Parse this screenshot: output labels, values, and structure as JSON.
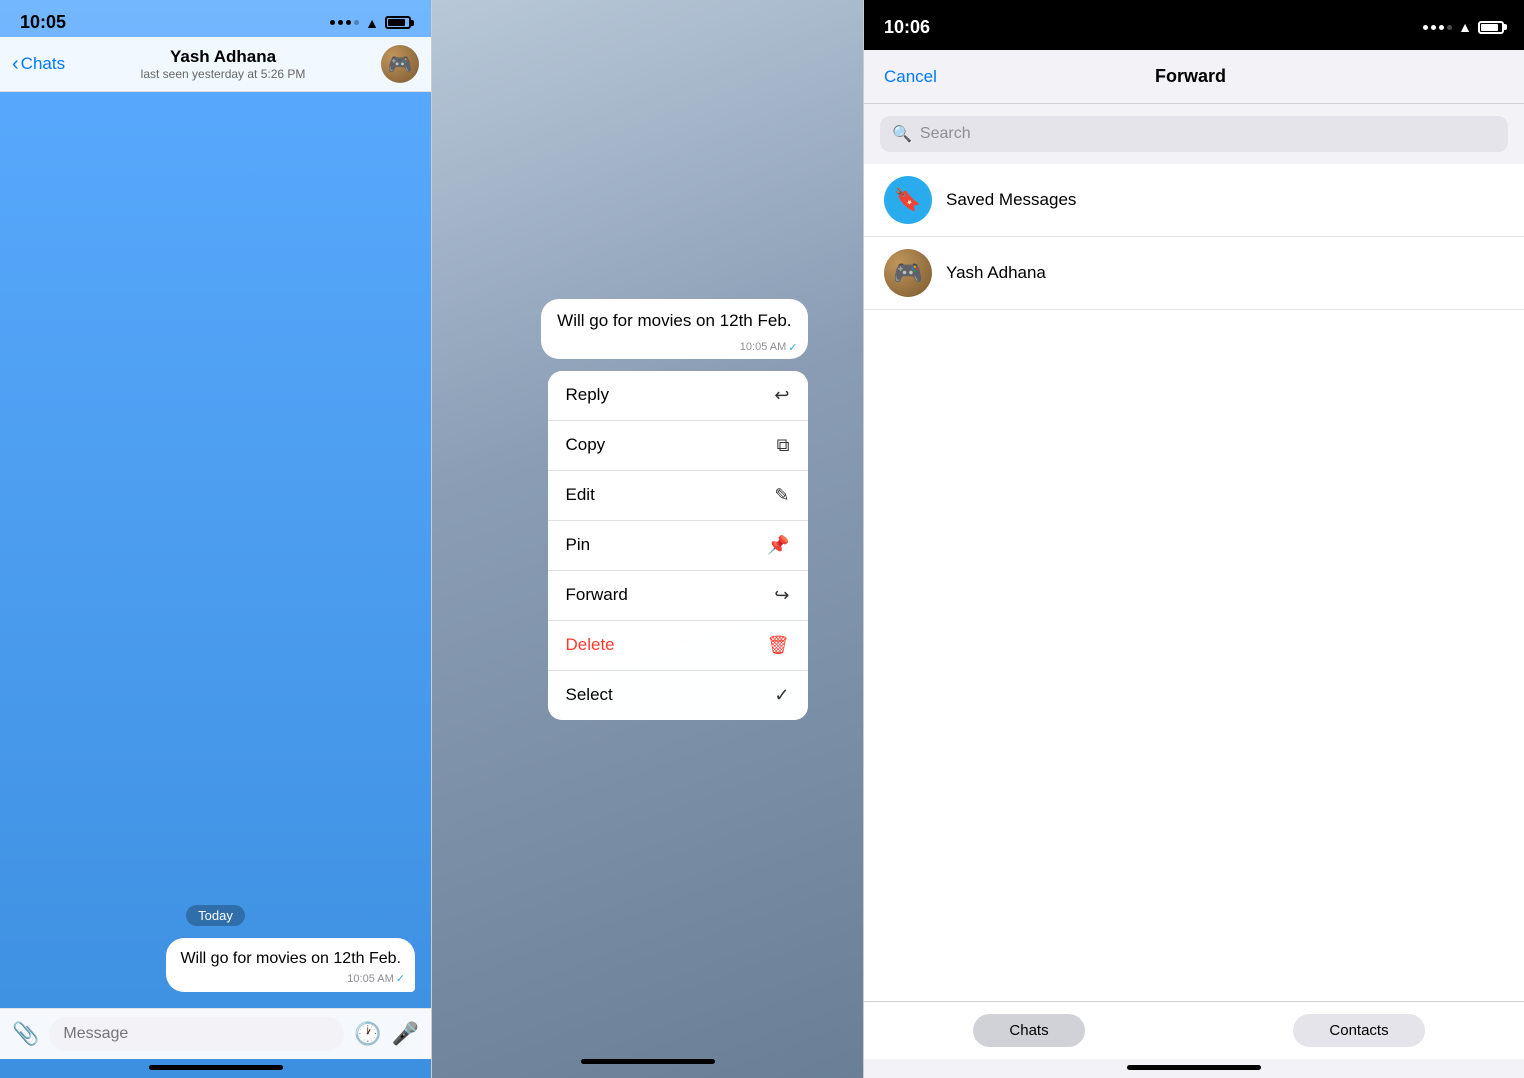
{
  "panel1": {
    "status_bar": {
      "time": "10:05"
    },
    "header": {
      "back_label": "Chats",
      "contact_name": "Yash Adhana",
      "contact_status": "last seen yesterday at 5:26 PM"
    },
    "messages": [
      {
        "date": "Today",
        "text": "Will go for movies on 12th Feb.",
        "time": "10:05 AM",
        "read": true
      }
    ],
    "input": {
      "placeholder": "Message"
    },
    "home_indicator": true
  },
  "panel2": {
    "preview_message": {
      "text": "Will go for movies on 12th Feb.",
      "time": "10:05 AM",
      "read": true
    },
    "context_menu": [
      {
        "label": "Reply",
        "icon": "↩",
        "danger": false
      },
      {
        "label": "Copy",
        "icon": "⧉",
        "danger": false
      },
      {
        "label": "Edit",
        "icon": "✎",
        "danger": false
      },
      {
        "label": "Pin",
        "icon": "📌",
        "danger": false
      },
      {
        "label": "Forward",
        "icon": "↪",
        "danger": false
      },
      {
        "label": "Delete",
        "icon": "🗑",
        "danger": true
      },
      {
        "label": "Select",
        "icon": "✓",
        "danger": false
      }
    ],
    "home_indicator": true
  },
  "panel3": {
    "status_bar": {
      "time": "10:06"
    },
    "header": {
      "cancel_label": "Cancel",
      "title": "Forward"
    },
    "search": {
      "placeholder": "Search"
    },
    "contacts": [
      {
        "name": "Saved Messages",
        "type": "saved"
      },
      {
        "name": "Yash Adhana",
        "type": "user"
      }
    ],
    "tabs": [
      {
        "label": "Chats",
        "active": true
      },
      {
        "label": "Contacts",
        "active": false
      }
    ]
  }
}
